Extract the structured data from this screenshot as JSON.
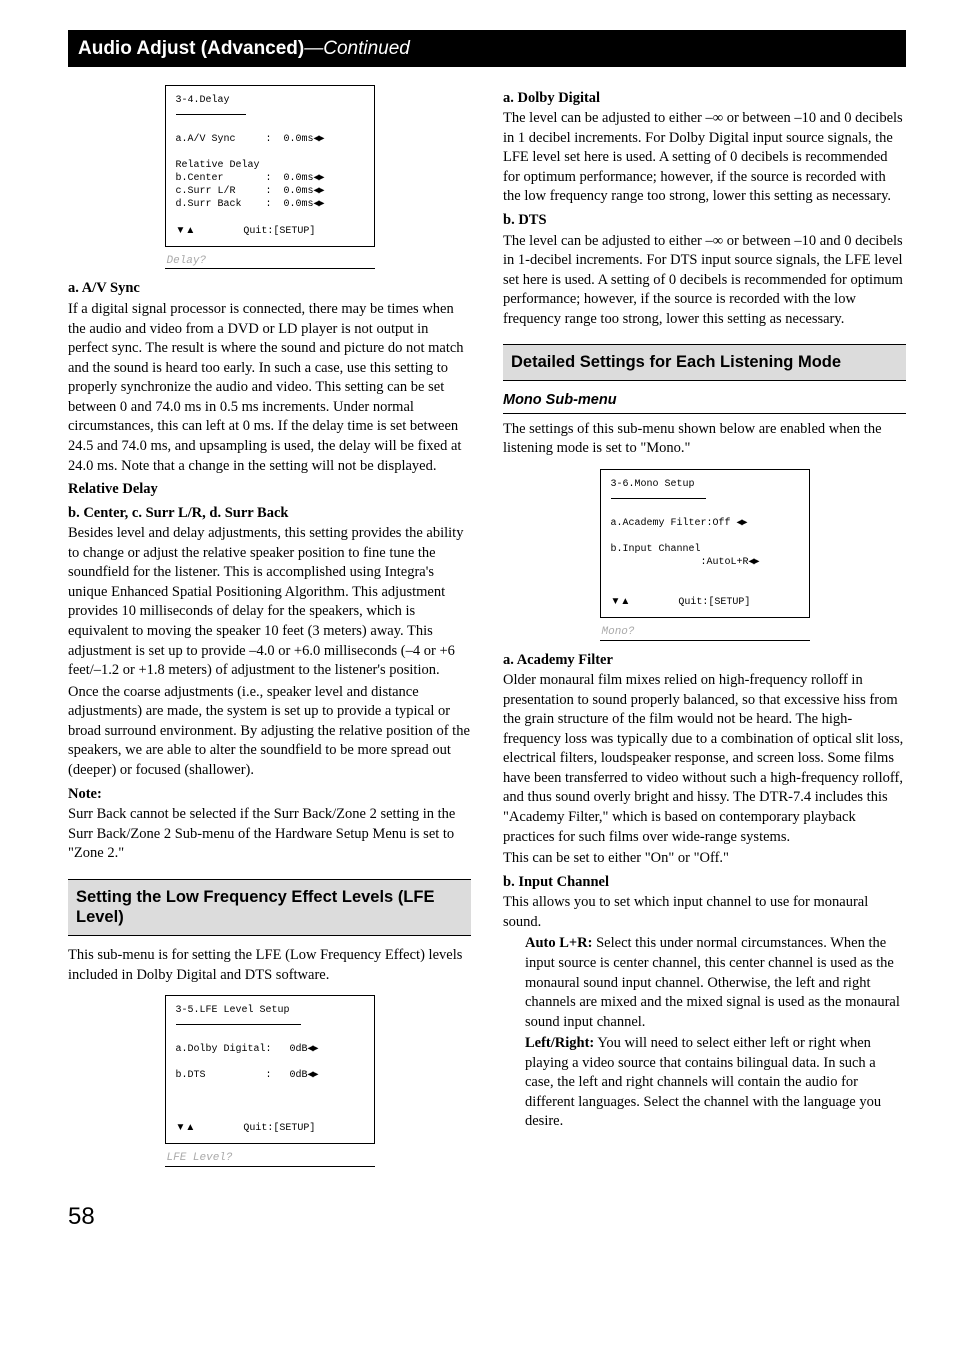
{
  "header": {
    "title": "Audio Adjust (Advanced)",
    "dash": "—",
    "cont": "Continued"
  },
  "leftCol": {
    "menu34": {
      "title": "3-4.Delay",
      "l1": "a.A/V Sync     :  0.0ms",
      "l1b": "◀▶",
      "rd": "Relative Delay",
      "l2": "b.Center       :  0.0ms",
      "l2b": "◀▶",
      "l3": "c.Surr L/R     :  0.0ms",
      "l3b": "◀▶",
      "l4": "d.Surr Back    :  0.0ms",
      "l4b": "◀▶",
      "foot_l": "▼▲",
      "foot_r": "Quit:[SETUP]",
      "caption": "Delay?"
    },
    "a_title": "a. A/V Sync",
    "a_body": "If a digital signal processor is connected, there may be times when the audio and video from a DVD or LD player is not output in perfect sync. The result is where the sound and picture do not match and the sound is heard too early. In such a case, use this setting to properly synchronize the audio and video. This setting can be set between 0 and 74.0 ms in 0.5 ms increments. Under normal circumstances, this can left at 0 ms. If the delay time is set between 24.5 and 74.0 ms, and upsampling is used, the delay will be fixed at 24.0 ms. Note that a change in the setting will not be displayed.",
    "rel_delay": "Relative Delay",
    "b_title": "b. Center, c. Surr L/R, d. Surr Back",
    "b_body1": "Besides level and delay adjustments, this setting provides the ability to change or adjust the relative speaker position to fine tune the soundfield for the listener. This is accomplished using Integra's unique Enhanced Spatial Positioning Algorithm. This adjustment provides 10 milliseconds of delay for the speakers, which is equivalent to moving the speaker 10 feet (3 meters) away. This adjustment is set up to provide –4.0 or +6.0 milliseconds (–4 or +6 feet/–1.2 or +1.8 meters) of adjustment to the listener's position.",
    "b_body2": "Once the coarse adjustments (i.e., speaker level and distance adjustments) are made, the system is set up to provide a typical or broad surround environment. By adjusting the relative position of the speakers, we are able to alter the soundfield to be more spread out (deeper) or focused (shallower).",
    "note_t": "Note:",
    "note_b": "Surr Back cannot be selected if the Surr Back/Zone 2 setting in the Surr Back/Zone 2 Sub-menu of the Hardware Setup Menu is set to \"Zone 2.\"",
    "section_lfe": "Setting the Low Frequency Effect Levels (LFE Level)",
    "lfe_intro": "This sub-menu is for setting the LFE (Low Frequency Effect) levels included in Dolby Digital and DTS software.",
    "menu35": {
      "title": "3-5.LFE Level Setup",
      "l1": "a.Dolby Digital:   0dB",
      "l1b": "◀▶",
      "l2": "b.DTS          :   0dB",
      "l2b": "◀▶",
      "foot_l": "▼▲",
      "foot_r": "Quit:[SETUP]",
      "caption": "LFE Level?"
    }
  },
  "rightCol": {
    "a_title": "a. Dolby Digital",
    "a_body": "The level can be adjusted to either –∞ or between –10 and 0 decibels in 1 decibel increments. For Dolby Digital input source signals, the LFE level set here is used. A setting of 0 decibels is recommended for optimum performance; however, if the source is recorded with the low frequency range too strong, lower this setting as necessary.",
    "b_title": "b. DTS",
    "b_body": "The level can be adjusted to either –∞ or between –10 and 0 decibels in 1-decibel increments. For DTS input source signals, the LFE level set here is used. A setting of 0 decibels is recommended for optimum performance; however, if the source is recorded with the low frequency range too strong, lower this setting as necessary.",
    "section_detailed": "Detailed Settings for Each Listening Mode",
    "mono_sub": "Mono Sub-menu",
    "mono_intro": "The settings of this sub-menu shown below are enabled when the listening mode is set to \"Mono.\"",
    "menu36": {
      "title": "3-6.Mono Setup",
      "l1": "a.Academy Filter:Off ",
      "l1b": "◀▶",
      "l2": "b.Input Channel",
      "l2b": "               :AutoL+R",
      "l2c": "◀▶",
      "foot_l": "▼▲",
      "foot_r": "Quit:[SETUP]",
      "caption": "Mono?"
    },
    "af_title": "a. Academy Filter",
    "af_body1": "Older monaural film mixes relied on high-frequency rolloff in presentation to sound properly balanced, so that excessive hiss from the grain structure of the film would not be heard. The high-frequency loss was typically due to a combination of optical slit loss, electrical filters, loudspeaker response, and screen loss. Some films have been transferred to video without such a high-frequency rolloff, and thus sound overly bright and hissy. The DTR-7.4 includes this \"Academy Filter,\" which is based on contemporary playback practices for such films over wide-range systems.",
    "af_body2": "This can be set to either \"On\" or \"Off.\"",
    "ic_title": "b. Input Channel",
    "ic_body": "This allows you to set which input channel to use for monaural sound.",
    "auto_t": "Auto L+R:",
    "auto_b": " Select this under normal circumstances. When the input source is center channel, this center channel is used as the monaural sound input channel. Otherwise, the left and right channels are mixed and the mixed signal is used as the monaural sound input channel.",
    "lr_t": "Left/Right:",
    "lr_b": " You will need to select either left or right when playing a video source that contains bilingual data. In such a case, the left and right channels will contain the audio for different languages. Select the channel with the language you desire."
  },
  "pageNum": "58"
}
